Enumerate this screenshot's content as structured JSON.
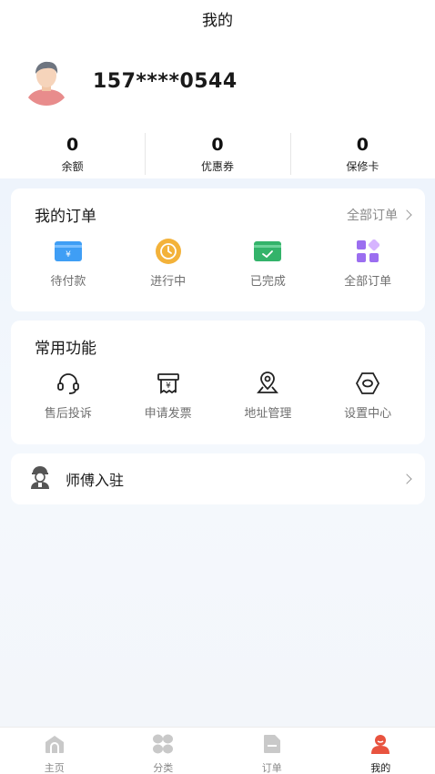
{
  "header": {
    "title": "我的"
  },
  "profile": {
    "phone": "157****0544"
  },
  "stats": [
    {
      "value": "0",
      "label": "余额"
    },
    {
      "value": "0",
      "label": "优惠券"
    },
    {
      "value": "0",
      "label": "保修卡"
    }
  ],
  "orders": {
    "title": "我的订单",
    "more": "全部订单",
    "items": [
      {
        "label": "待付款",
        "icon": "payment-card-icon"
      },
      {
        "label": "进行中",
        "icon": "clock-icon"
      },
      {
        "label": "已完成",
        "icon": "check-card-icon"
      },
      {
        "label": "全部订单",
        "icon": "grid-icon"
      }
    ]
  },
  "functions": {
    "title": "常用功能",
    "items": [
      {
        "label": "售后投诉",
        "icon": "headset-icon"
      },
      {
        "label": "申请发票",
        "icon": "invoice-icon"
      },
      {
        "label": "地址管理",
        "icon": "location-pin-icon"
      },
      {
        "label": "设置中心",
        "icon": "settings-hexagon-icon"
      }
    ]
  },
  "master": {
    "label": "师傅入驻",
    "icon": "worker-icon"
  },
  "tabbar": [
    {
      "label": "主页",
      "icon": "home-icon",
      "active": false
    },
    {
      "label": "分类",
      "icon": "category-icon",
      "active": false
    },
    {
      "label": "订单",
      "icon": "order-doc-icon",
      "active": false
    },
    {
      "label": "我的",
      "icon": "profile-icon",
      "active": true
    }
  ],
  "colors": {
    "accent": "#e8533f",
    "payment": "#3f9ef5",
    "progress": "#f3b23a",
    "done": "#33b36a",
    "all": "#9b6ef0"
  }
}
